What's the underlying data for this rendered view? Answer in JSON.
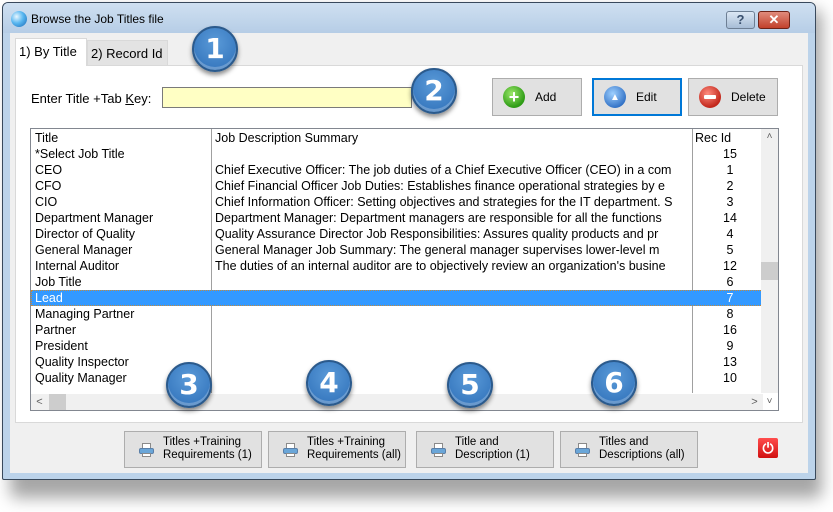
{
  "window": {
    "title": "Browse the Job Titles file",
    "help_label": "?",
    "close_label": "✕"
  },
  "tabs": [
    {
      "label": "1) By Title",
      "active": true
    },
    {
      "label": "2) Record Id",
      "active": false
    }
  ],
  "search": {
    "label_prefix": "Enter Title +Tab ",
    "label_mnemonic": "K",
    "label_suffix": "ey:",
    "value": "",
    "placeholder": ""
  },
  "actions": {
    "add": "Add",
    "edit": "Edit",
    "delete": "Delete"
  },
  "grid": {
    "columns": [
      "Title",
      "Job Description Summary",
      "Rec Id"
    ],
    "rows": [
      {
        "title": "*Select Job Title",
        "desc": "",
        "rec": "15"
      },
      {
        "title": "CEO",
        "desc": "Chief Executive Officer: The job duties of a Chief Executive Officer (CEO) in a com",
        "rec": "1"
      },
      {
        "title": "CFO",
        "desc": "Chief Financial Officer Job Duties: Establishes finance operational strategies by e",
        "rec": "2"
      },
      {
        "title": "CIO",
        "desc": "Chief Information Officer: Setting objectives and strategies for the IT department. S",
        "rec": "3"
      },
      {
        "title": "Department Manager",
        "desc": "Department Manager: Department managers are responsible for all the functions",
        "rec": "14"
      },
      {
        "title": "Director of Quality",
        "desc": "Quality Assurance Director Job Responsibilities: Assures quality products and pr",
        "rec": "4"
      },
      {
        "title": "General Manager",
        "desc": "General Manager Job Summary: The general manager supervises lower-level m",
        "rec": "5"
      },
      {
        "title": "Internal Auditor",
        "desc": "The duties of an internal auditor are to objectively review an organization's busine",
        "rec": "12"
      },
      {
        "title": "Job Title",
        "desc": "",
        "rec": "6"
      },
      {
        "title": "Lead",
        "desc": "",
        "rec": "7",
        "selected": true
      },
      {
        "title": "Managing Partner",
        "desc": "",
        "rec": "8"
      },
      {
        "title": "Partner",
        "desc": "",
        "rec": "16"
      },
      {
        "title": "President",
        "desc": "",
        "rec": "9"
      },
      {
        "title": "Quality Inspector",
        "desc": "",
        "rec": "13"
      },
      {
        "title": "Quality Manager",
        "desc": "",
        "rec": "10"
      }
    ],
    "scroll": {
      "up": "˄",
      "down": "˅",
      "left": "<",
      "right": ">"
    }
  },
  "print_buttons": [
    {
      "line1": "Titles +Training",
      "line2": "Requirements (1)"
    },
    {
      "line1": "Titles +Training",
      "line2": "Requirements (all)"
    },
    {
      "line1": "Title and",
      "line2": "Description (1)"
    },
    {
      "line1": "Titles and",
      "line2": "Descriptions (all)"
    }
  ],
  "power_icon": "⏻",
  "callouts": [
    "1",
    "2",
    "3",
    "4",
    "5",
    "6"
  ]
}
